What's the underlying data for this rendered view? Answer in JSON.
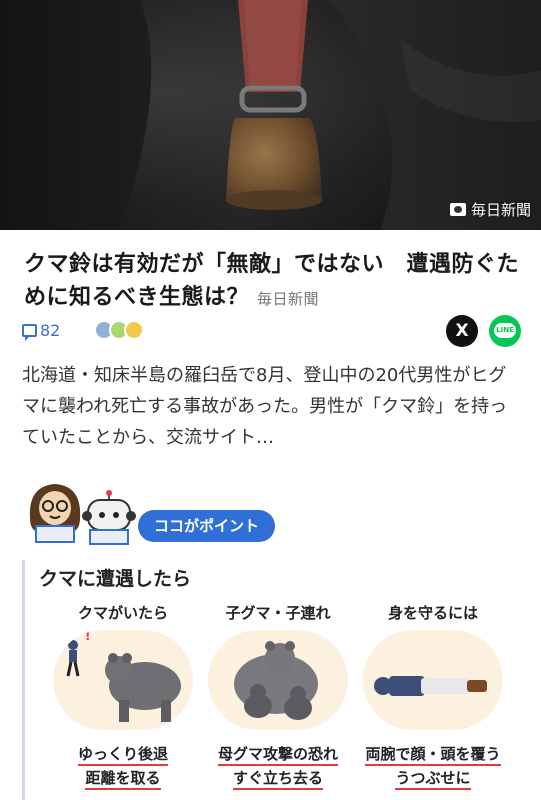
{
  "hero": {
    "credit": "毎日新聞",
    "credit_icon": "camera-icon"
  },
  "article": {
    "title": "クマ鈴は有効だが「無敵」ではない　遭遇防ぐために知るべき生態は？",
    "source": "毎日新聞",
    "comments": "82",
    "summary": "北海道・知床半島の羅臼岳で8月、登山中の20代男性がヒグマに襲われ死亡する事故があった。男性が「クマ鈴」を持っていたことから、交流サイト…"
  },
  "share": {
    "x_label": "X",
    "line_label": "LINE"
  },
  "point": {
    "badge": "ココがポイント"
  },
  "infographic": {
    "heading": "クマに遭遇したら",
    "panels": [
      {
        "title": "クマがいたら",
        "caption_line1": "ゆっくり後退",
        "caption_line2": "距離を取る"
      },
      {
        "title": "子グマ・子連れ",
        "caption_line1": "母グマ攻撃の恐れ",
        "caption_line2": "すぐ立ち去る"
      },
      {
        "title": "身を守るには",
        "caption_line1": "両腕で顔・頭を覆う",
        "caption_line2": "うつぶせに"
      }
    ]
  },
  "colors": {
    "accent_blue": "#2f6fd6",
    "line_green": "#06c755",
    "underline_red": "#e23b3b"
  }
}
